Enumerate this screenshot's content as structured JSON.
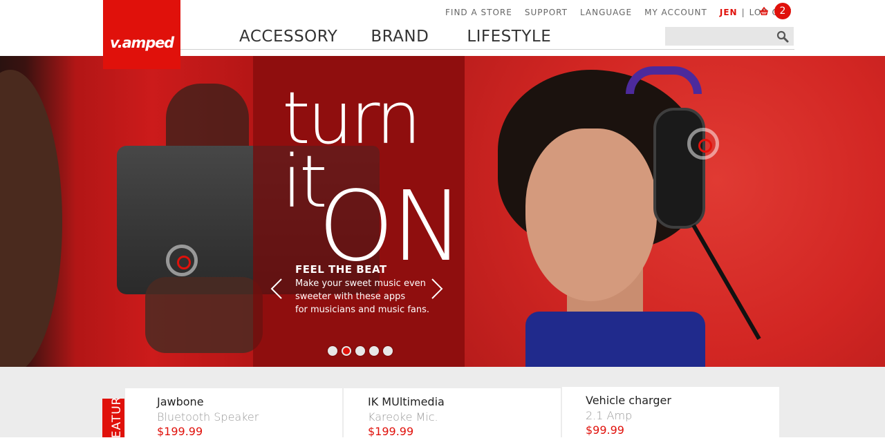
{
  "brand": {
    "logo_text": "v.amped",
    "accent_color": "#e0110b"
  },
  "utility_nav": {
    "items": [
      "FIND A STORE",
      "SUPPORT",
      "LANGUAGE",
      "MY ACCOUNT"
    ],
    "user": "JEN",
    "separator": "|",
    "logout": "LOG OUT",
    "cart_icon": "basket-icon",
    "cart_count": "2"
  },
  "main_nav": {
    "items": [
      "ACCESSORY",
      "BRAND",
      "LIFESTYLE"
    ]
  },
  "search": {
    "placeholder": "",
    "icon": "magnifier-icon"
  },
  "hero": {
    "headline_line1": "turn",
    "headline_line2": "it",
    "headline_line3": "ON",
    "slide_title": "FEEL THE BEAT",
    "slide_lines": [
      "Make your sweet music even",
      "sweeter with these apps",
      "for musicians and music fans."
    ],
    "active_slide": 2,
    "slide_count": 5
  },
  "featured": {
    "label": "FEATURED",
    "products": [
      {
        "name": "Jawbone",
        "subtitle": "Bluetooth Speaker",
        "price": "$199.99"
      },
      {
        "name": "IK MUltimedia",
        "subtitle": "Kareoke Mic.",
        "price": "$199.99"
      },
      {
        "name": "Vehicle charger",
        "subtitle": "2.1 Amp",
        "price": "$99.99"
      }
    ]
  }
}
